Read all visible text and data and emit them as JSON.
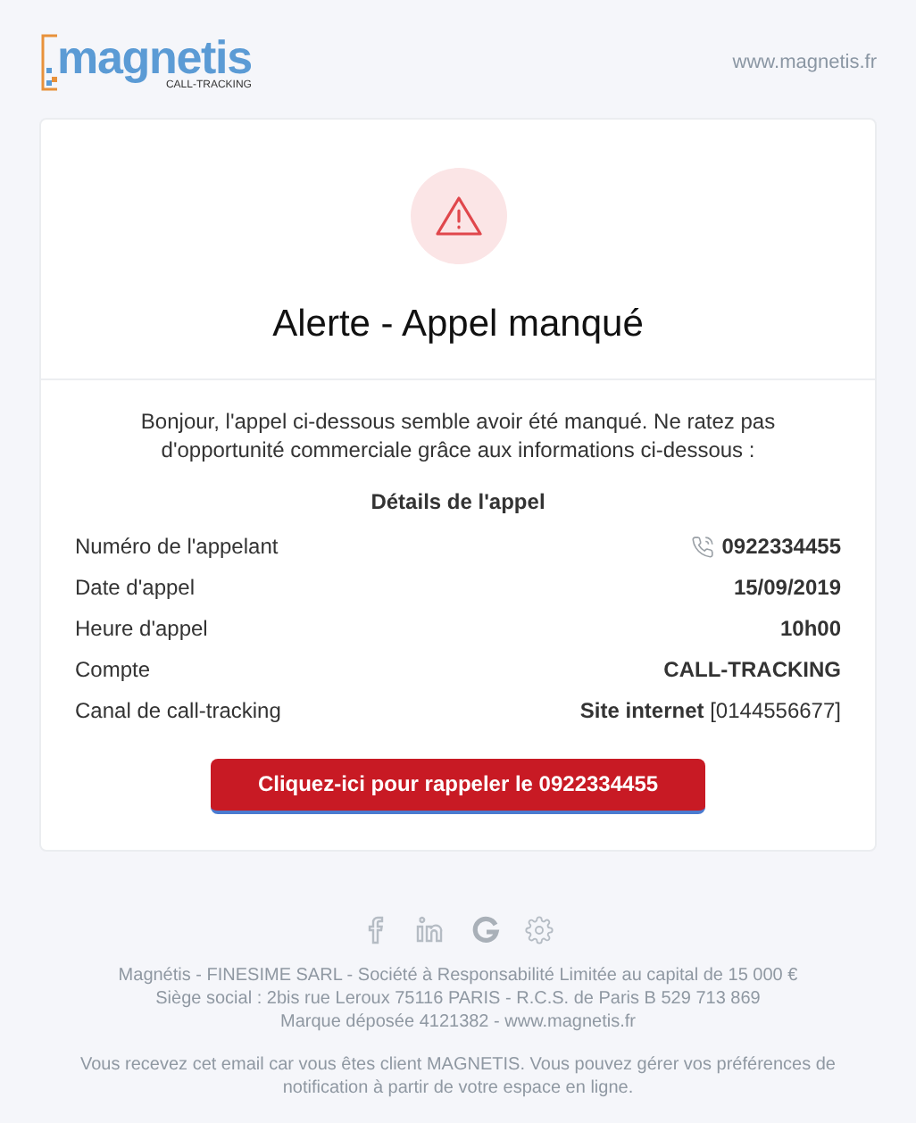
{
  "header": {
    "logo": {
      "name": "magnetis",
      "tagline": "CALL-TRACKING"
    },
    "website": "www.magnetis.fr"
  },
  "card": {
    "title": "Alerte - Appel manqué",
    "intro": "Bonjour, l'appel ci-dessous semble avoir été manqué. Ne ratez pas d'opportunité commerciale grâce aux informations ci-dessous :",
    "details_title": "Détails de l'appel",
    "rows": [
      {
        "kind": "phone",
        "label": "Numéro de l'appelant",
        "value": "**0922334455**"
      },
      {
        "kind": "plain",
        "label": "Date d'appel",
        "value": "**15/09/2019**"
      },
      {
        "kind": "plain",
        "label": "Heure d'appel",
        "value": "**10h00**"
      },
      {
        "kind": "plain",
        "label": "Compte",
        "value": "**CALL-TRACKING**"
      },
      {
        "kind": "plain",
        "label": "Canal de call-tracking",
        "value": "**Site internet** [0144556677]"
      }
    ],
    "button": "Cliquez-ici pour rappeler le 0922334455"
  },
  "footer": {
    "company_lines": [
      "Magnétis - FINESIME SARL - Société à Responsabilité Limitée au capital de 15 000 €",
      "Siège social : 2bis rue Leroux 75116 PARIS - R.C.S. de Paris B 529 713 869",
      "Marque déposée 4121382 - www.magnetis.fr"
    ],
    "notice": "Vous recevez cet email car vous êtes client MAGNETIS. Vous pouvez gérer vos préférences de notification à partir de votre espace en ligne."
  }
}
